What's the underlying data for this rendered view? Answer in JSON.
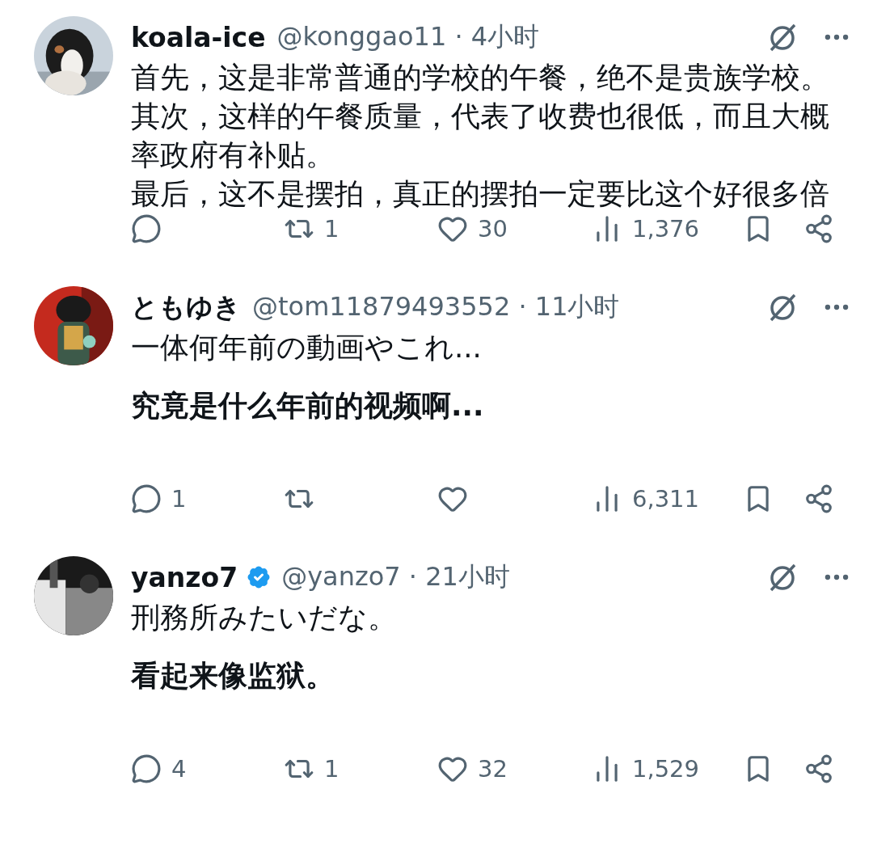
{
  "replies": [
    {
      "avatar": {
        "kind": "picture"
      },
      "name": "koala-ice",
      "verified": false,
      "handle": "@konggao11",
      "separator": "·",
      "time": "4小时",
      "body": [
        {
          "kind": "original",
          "text": "首先，这是非常普通的学校的午餐，绝不是贵族学校。"
        },
        {
          "kind": "original",
          "text": "其次，这样的午餐质量，代表了收费也很低，而且大概率政府有补贴。"
        },
        {
          "kind": "original",
          "text": "最后，这不是摆拍，真正的摆拍一定要比这个好很多倍"
        }
      ],
      "actions": [
        {
          "kind": "reply"
        },
        {
          "kind": "repost",
          "count": "1"
        },
        {
          "kind": "like",
          "count": "30"
        },
        {
          "kind": "views",
          "count": "1,376"
        },
        {
          "kind": "bookmark"
        },
        {
          "kind": "share"
        }
      ]
    },
    {
      "avatar": {
        "kind": "picture"
      },
      "name": "ともゆき",
      "verified": false,
      "handle": "@tom11879493552",
      "separator": "·",
      "time": "11小时",
      "body": [
        {
          "kind": "original",
          "text": "一体何年前の動画やこれ..."
        },
        {
          "kind": "translation",
          "text": "究竟是什么年前的视频啊..."
        }
      ],
      "actions": [
        {
          "kind": "reply",
          "count": "1"
        },
        {
          "kind": "repost"
        },
        {
          "kind": "like"
        },
        {
          "kind": "views",
          "count": "6,311"
        },
        {
          "kind": "bookmark"
        },
        {
          "kind": "share"
        }
      ]
    },
    {
      "avatar": {
        "kind": "picture"
      },
      "name": "yanzo7",
      "verified": true,
      "handle": "@yanzo7",
      "separator": "·",
      "time": "21小时",
      "body": [
        {
          "kind": "original",
          "text": "刑務所みたいだな。"
        },
        {
          "kind": "translation",
          "text": "看起来像监狱。"
        }
      ],
      "actions": [
        {
          "kind": "reply",
          "count": "4"
        },
        {
          "kind": "repost",
          "count": "1"
        },
        {
          "kind": "like",
          "count": "32"
        },
        {
          "kind": "views",
          "count": "1,529"
        },
        {
          "kind": "bookmark"
        },
        {
          "kind": "share"
        }
      ]
    }
  ]
}
